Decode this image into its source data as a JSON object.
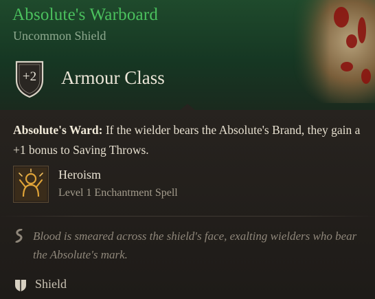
{
  "item": {
    "title": "Absolute's Warboard",
    "rarity": "Uncommon Shield",
    "armour_class": {
      "value": "+2",
      "label": "Armour Class"
    },
    "passive": {
      "name": "Absolute's Ward:",
      "description": " If the wielder bears the Absolute's Brand, they gain a +1 bonus to Saving Throws."
    },
    "spell": {
      "name": "Heroism",
      "subtitle": "Level 1 Enchantment Spell",
      "icon": "heroism-icon"
    },
    "flavor_text": "Blood is smeared across the shield's face, exalting wielders who bear the Absolute's mark.",
    "type": {
      "label": "Shield",
      "icon": "shield-icon"
    }
  },
  "colors": {
    "title_green": "#4bc15e",
    "header_bg": "#1f4a2c",
    "body_bg": "#1e1b18"
  }
}
